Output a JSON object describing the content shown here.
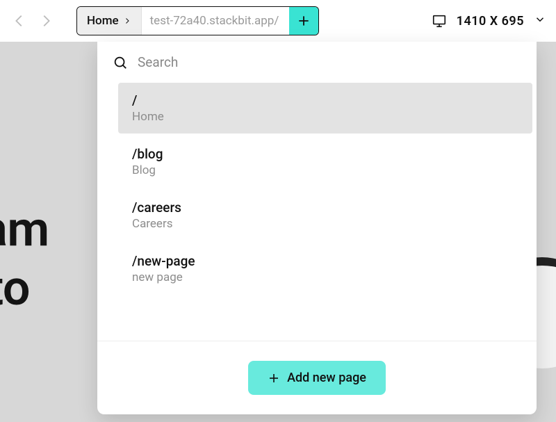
{
  "topbar": {
    "crumb_label": "Home",
    "url_path": "test-72a40.stackbit.app/",
    "viewport": "1410 X 695"
  },
  "dropdown": {
    "search_placeholder": "Search",
    "add_page_label": "Add new page",
    "pages": [
      {
        "path": "/",
        "title": "Home",
        "selected": true,
        "expandable": false
      },
      {
        "path": "/blog",
        "title": "Blog",
        "selected": false,
        "expandable": true
      },
      {
        "path": "/careers",
        "title": "Careers",
        "selected": false,
        "expandable": false
      },
      {
        "path": "/new-page",
        "title": "new page",
        "selected": false,
        "expandable": false
      }
    ]
  },
  "background": {
    "line1": "A team",
    "line2": "one to"
  }
}
